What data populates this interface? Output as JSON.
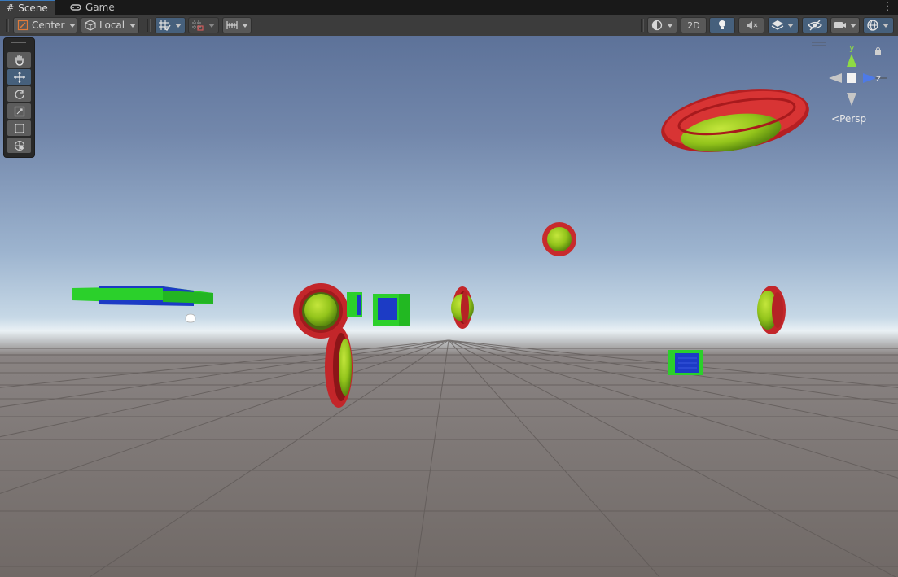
{
  "tabs": [
    {
      "label": "Scene",
      "icon": "hash-grid-icon",
      "active": true
    },
    {
      "label": "Game",
      "icon": "gamepad-icon",
      "active": false
    }
  ],
  "toolbar": {
    "pivot_label": "Center",
    "space_label": "Local",
    "mode_2d_label": "2D"
  },
  "gizmo": {
    "y_label": "y",
    "z_label": "z",
    "projection_label": "Persp"
  },
  "tools": [
    "hand-tool",
    "move-tool",
    "rotate-tool",
    "scale-tool",
    "rect-tool",
    "transform-tool"
  ],
  "colors": {
    "accent": "#46607c",
    "torus_red": "#c0262a",
    "sphere_green": "#9ccd1e",
    "cube_green": "#24d32c",
    "cube_blue": "#1b3cc8"
  }
}
